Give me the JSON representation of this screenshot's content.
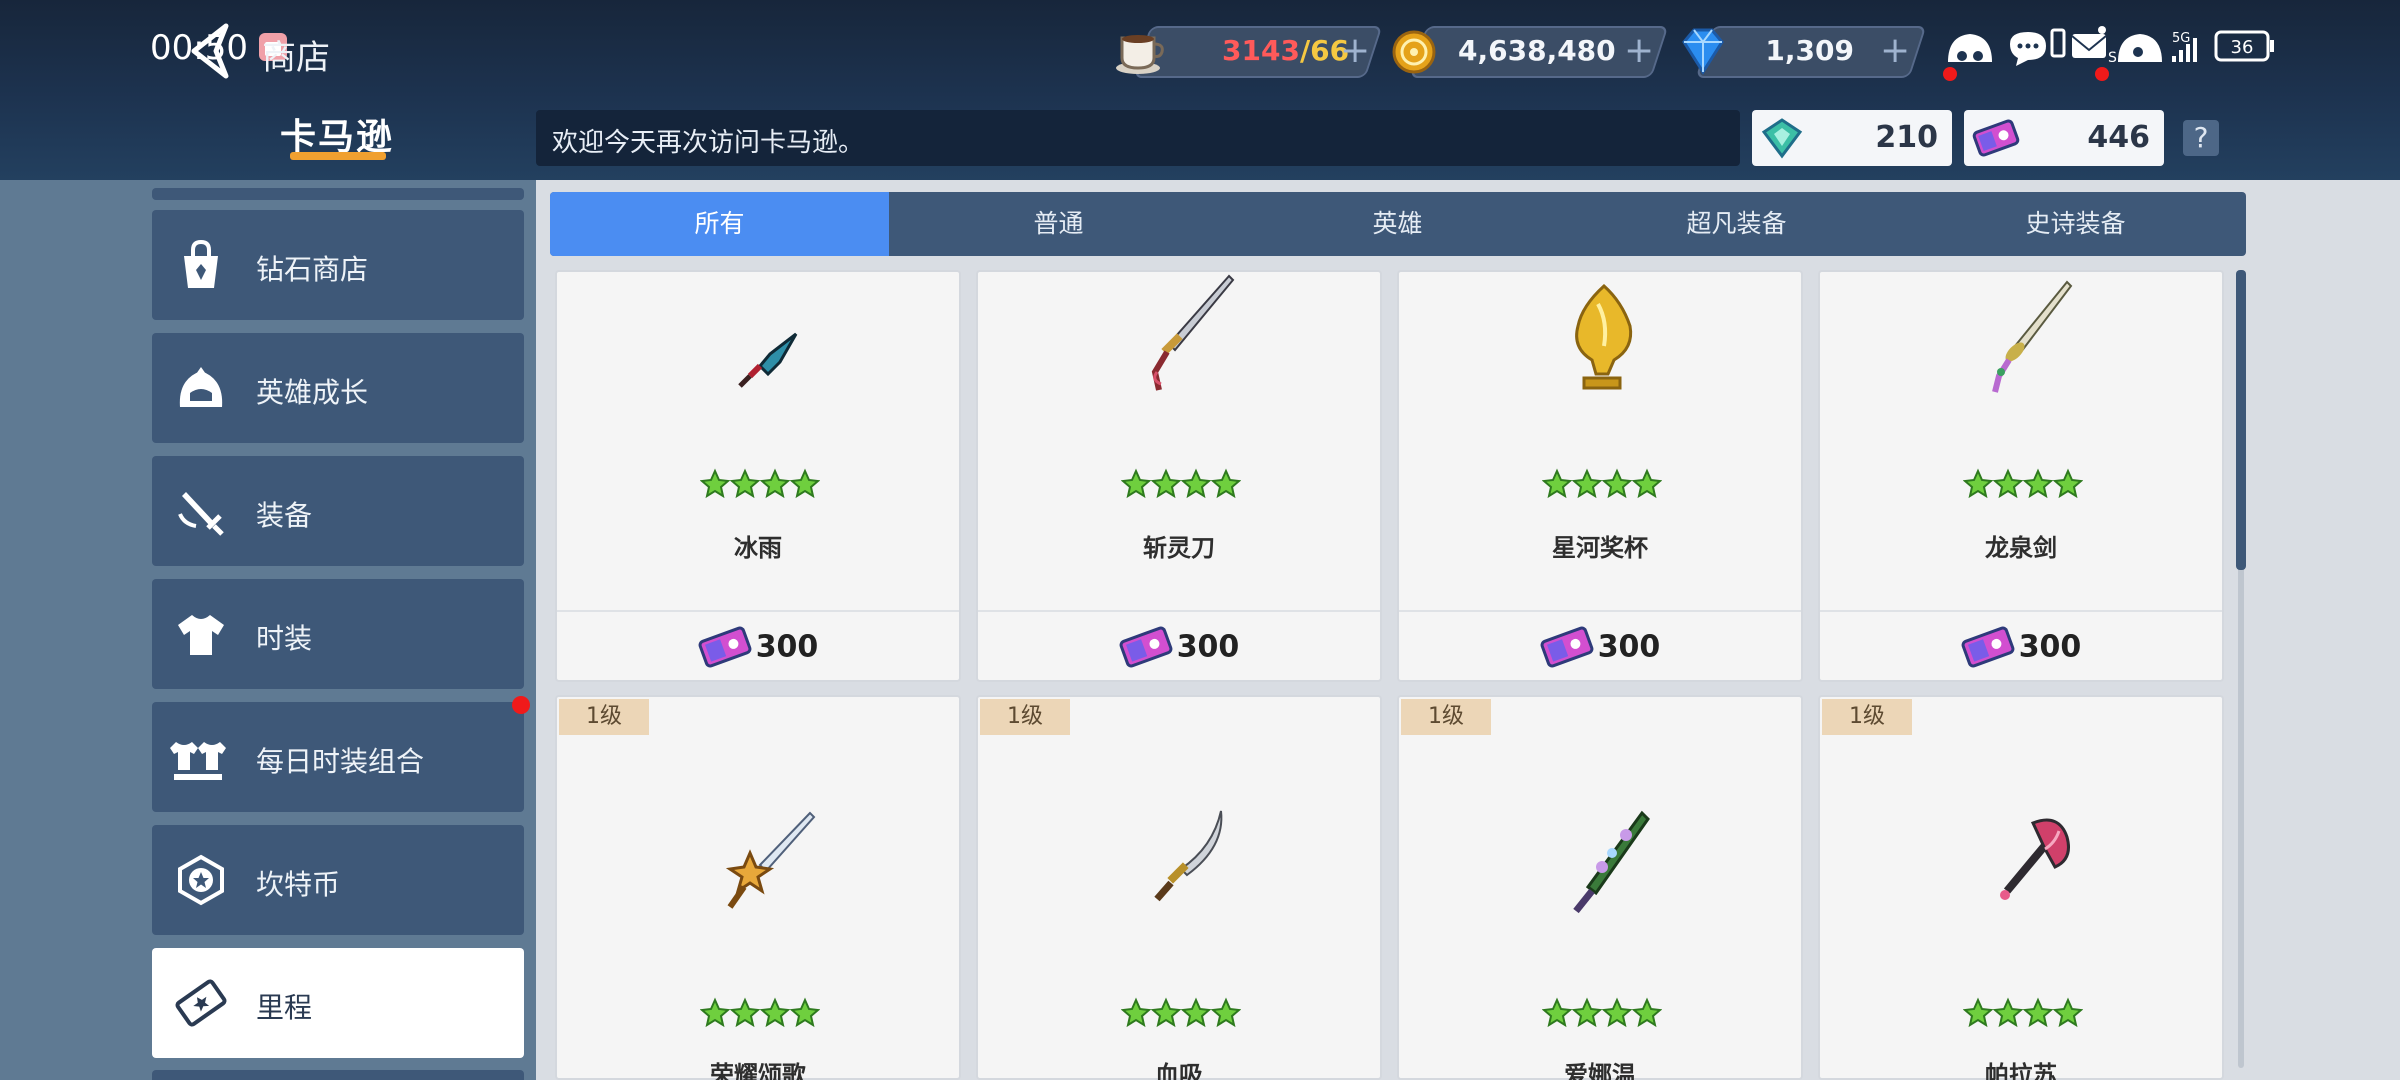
{
  "status": {
    "time": "00:50",
    "battery": "36",
    "network": "5G"
  },
  "header": {
    "title": "商店",
    "resources": [
      {
        "name": "stamina",
        "icon": "coffee-cup-icon",
        "value_current": "3143",
        "value_max": "/66",
        "current_color": "#ff5a5a",
        "max_color": "#f5c842"
      },
      {
        "name": "gold",
        "icon": "gold-coin-icon",
        "value": "4,638,480"
      },
      {
        "name": "gems",
        "icon": "blue-gem-icon",
        "value": "1,309"
      }
    ],
    "plus": "+"
  },
  "shop": {
    "logo": "卡马逊",
    "welcome": "欢迎今天再次访问卡马逊。",
    "tokens": [
      {
        "icon": "green-token-icon",
        "value": "210"
      },
      {
        "icon": "mileage-ticket-icon",
        "value": "446"
      }
    ],
    "help": "?"
  },
  "sidebar": {
    "items": [
      {
        "label": "钻石商店",
        "icon": "shopping-bag-icon"
      },
      {
        "label": "英雄成长",
        "icon": "hero-helmet-icon"
      },
      {
        "label": "装备",
        "icon": "sword-icon"
      },
      {
        "label": "时装",
        "icon": "costume-shirt-icon"
      },
      {
        "label": "每日时装组合",
        "icon": "costume-set-icon",
        "badge": true
      },
      {
        "label": "坎特币",
        "icon": "kant-coin-icon"
      },
      {
        "label": "里程",
        "icon": "ticket-icon",
        "active": true
      }
    ]
  },
  "tabs": [
    {
      "label": "所有",
      "active": true
    },
    {
      "label": "普通"
    },
    {
      "label": "英雄"
    },
    {
      "label": "超凡装备"
    },
    {
      "label": "史诗装备"
    }
  ],
  "items": [
    {
      "name": "冰雨",
      "price": "300",
      "stars": 4,
      "art": "dagger"
    },
    {
      "name": "斩灵刀",
      "price": "300",
      "stars": 4,
      "art": "katana"
    },
    {
      "name": "星河奖杯",
      "price": "300",
      "stars": 4,
      "art": "trophy"
    },
    {
      "name": "龙泉剑",
      "price": "300",
      "stars": 4,
      "art": "rapier"
    },
    {
      "name": "荣耀颂歌",
      "level": "1级",
      "stars": 4,
      "art": "star-sword"
    },
    {
      "name": "血吸",
      "level": "1级",
      "stars": 4,
      "art": "scimitar"
    },
    {
      "name": "爱娜温",
      "level": "1级",
      "stars": 4,
      "art": "vine-sword"
    },
    {
      "name": "帕拉苏",
      "level": "1级",
      "stars": 4,
      "art": "axe"
    }
  ]
}
